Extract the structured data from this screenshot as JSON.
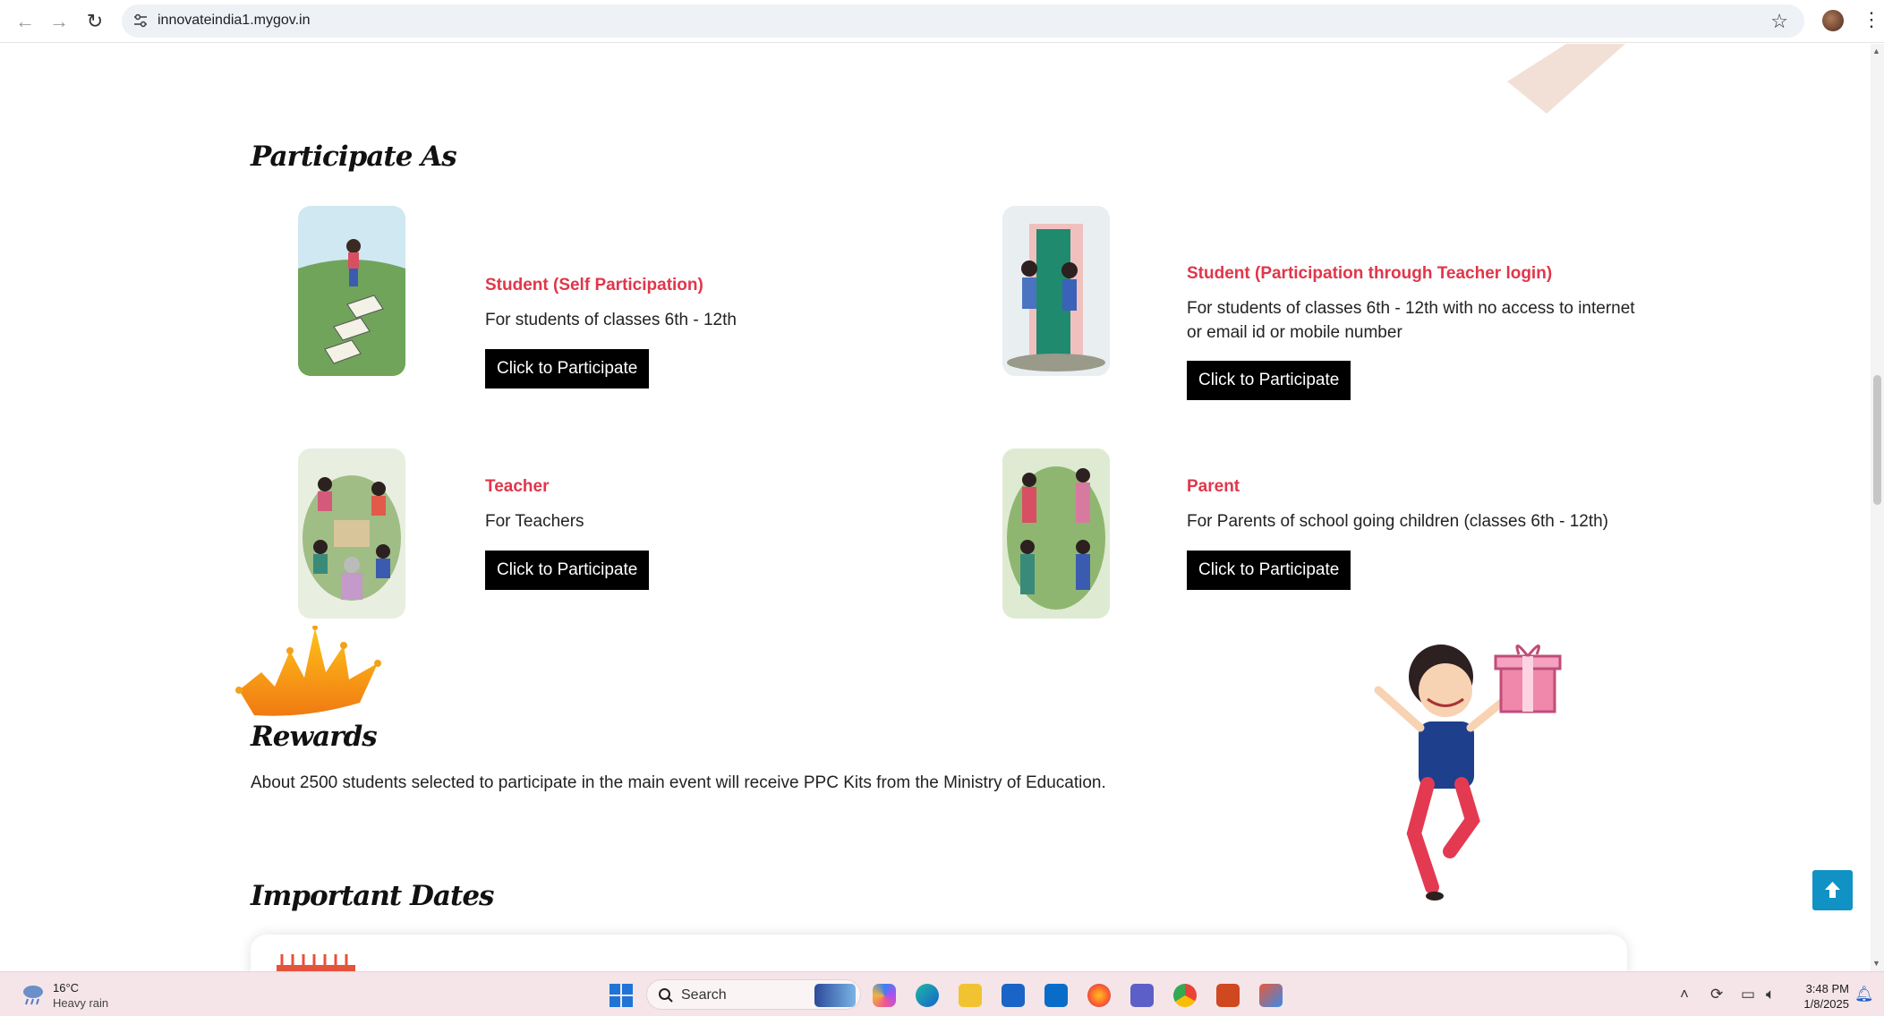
{
  "browser": {
    "url": "innovateindia1.mygov.in"
  },
  "participate": {
    "heading": "Participate As",
    "cards": [
      {
        "title": "Student (Self Participation)",
        "desc": "For students of classes 6th - 12th",
        "button": "Click to Participate"
      },
      {
        "title": "Student (Participation through Teacher login)",
        "desc": "For students of classes 6th - 12th with no access to internet or email id or mobile number",
        "button": "Click to Participate"
      },
      {
        "title": "Teacher",
        "desc": "For Teachers",
        "button": "Click to Participate"
      },
      {
        "title": "Parent",
        "desc": "For Parents of school going children (classes 6th - 12th)",
        "button": "Click to Participate"
      }
    ]
  },
  "rewards": {
    "heading": "Rewards",
    "text": "About 2500 students selected to participate in the main event will receive PPC Kits from the Ministry of Education."
  },
  "dates": {
    "heading": "Important Dates"
  },
  "taskbar": {
    "temperature": "16°C",
    "condition": "Heavy rain",
    "search_label": "Search",
    "time": "3:48 PM",
    "date": "1/8/2025"
  },
  "colors": {
    "accent_red": "#e0364a",
    "button_black": "#000000",
    "back_to_top_blue": "#1192c4"
  },
  "icons": [
    "back-arrow-icon",
    "forward-arrow-icon",
    "reload-icon",
    "site-settings-icon",
    "bookmark-star-icon",
    "profile-avatar",
    "kebab-menu-icon",
    "arrow-up-icon",
    "windows-start-icon",
    "search-icon"
  ]
}
